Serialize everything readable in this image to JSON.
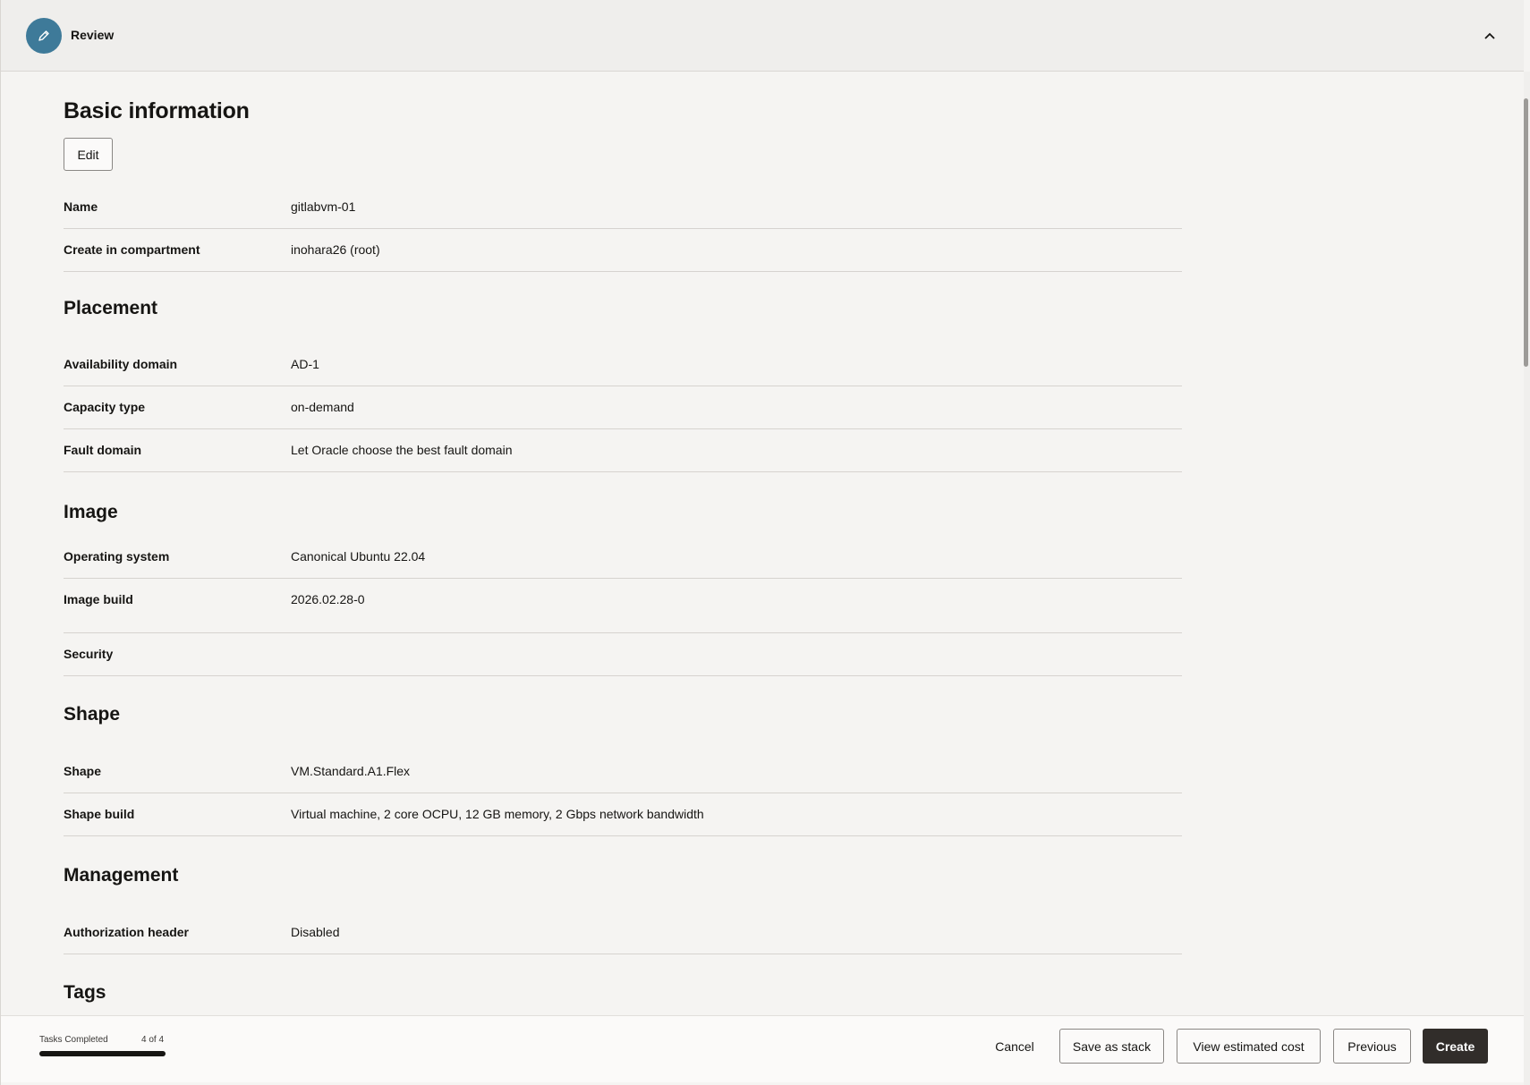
{
  "header": {
    "step_title": "Review",
    "step_icon": "pencil-icon",
    "collapse_icon": "chevron-up-icon"
  },
  "basic_information": {
    "title": "Basic information",
    "edit_label": "Edit",
    "rows": [
      {
        "label": "Name",
        "value": "gitlabvm-01"
      },
      {
        "label": "Create in compartment",
        "value": "inohara26 (root)"
      }
    ]
  },
  "placement": {
    "title": "Placement",
    "rows": [
      {
        "label": "Availability domain",
        "value": "AD-1"
      },
      {
        "label": "Capacity type",
        "value": "on-demand"
      },
      {
        "label": "Fault domain",
        "value": "Let Oracle choose the best fault domain"
      }
    ]
  },
  "image": {
    "title": "Image",
    "rows": [
      {
        "label": "Operating system",
        "value": "Canonical Ubuntu 22.04"
      },
      {
        "label": "Image build",
        "value": "2026.02.28-0"
      },
      {
        "label": "Security",
        "value": ""
      }
    ]
  },
  "shape": {
    "title": "Shape",
    "rows": [
      {
        "label": "Shape",
        "value": "VM.Standard.A1.Flex"
      },
      {
        "label": "Shape build",
        "value": "Virtual machine, 2 core OCPU, 12 GB memory, 2 Gbps network bandwidth"
      }
    ]
  },
  "management": {
    "title": "Management",
    "rows": [
      {
        "label": "Authorization header",
        "value": "Disabled"
      }
    ]
  },
  "tags": {
    "title": "Tags"
  },
  "footer": {
    "tasks_label": "Tasks Completed",
    "tasks_count": "4 of 4",
    "progress_fraction": 1.0,
    "cancel_label": "Cancel",
    "save_stack_label": "Save as stack",
    "estimated_cost_label": "View estimated cost",
    "previous_label": "Previous",
    "create_label": "Create"
  },
  "colors": {
    "step_icon_bg": "#3e7a99",
    "primary_button_bg": "#312d2a"
  }
}
